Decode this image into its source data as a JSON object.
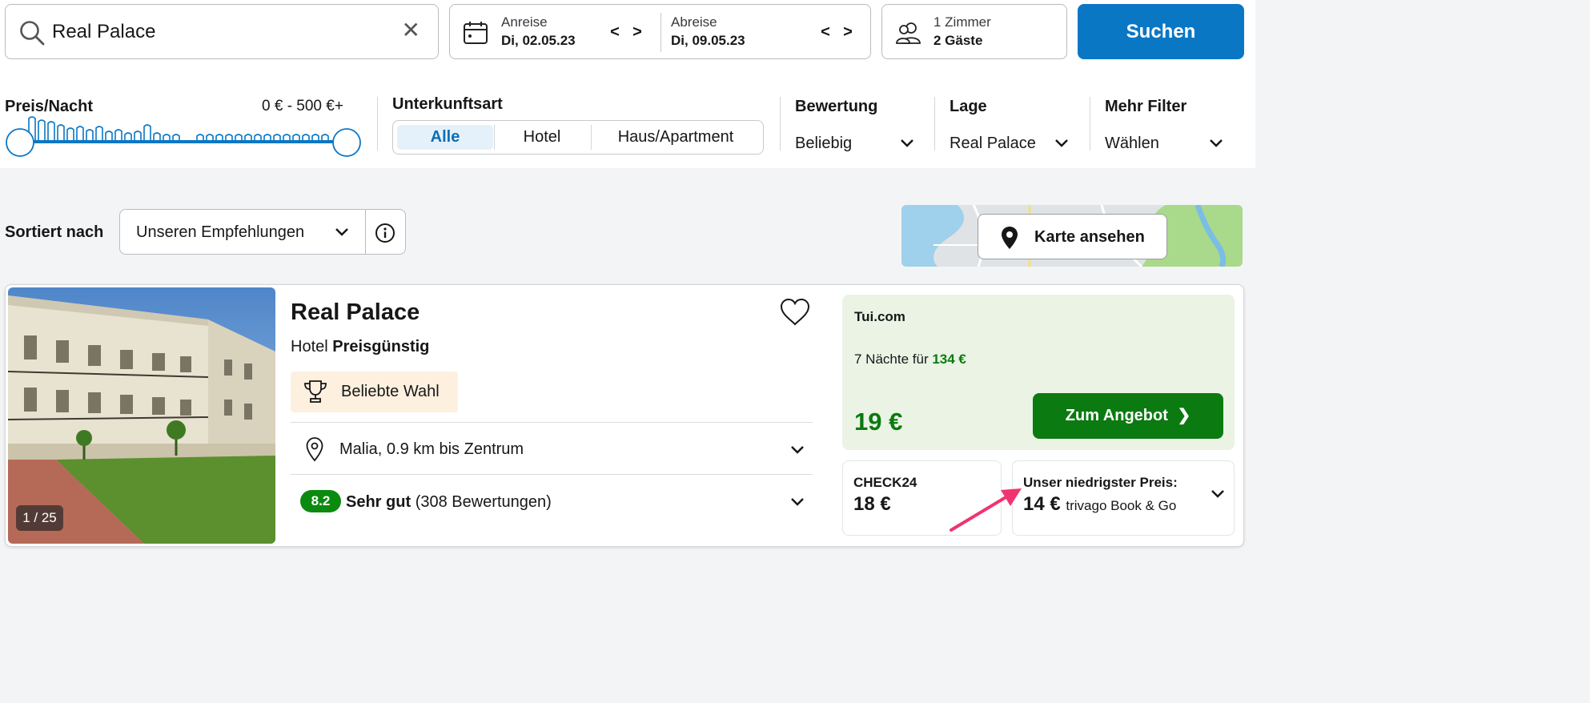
{
  "search": {
    "query": "Real Palace",
    "clear_icon": "close-icon"
  },
  "dates": {
    "checkin_label": "Anreise",
    "checkin_value": "Di, 02.05.23",
    "checkout_label": "Abreise",
    "checkout_value": "Di, 09.05.23"
  },
  "guests": {
    "rooms": "1 Zimmer",
    "guests": "2 Gäste"
  },
  "search_button": "Suchen",
  "filters": {
    "price": {
      "title": "Preis/Nacht",
      "range": "0 € - 500 €+"
    },
    "type": {
      "title": "Unterkunftsart",
      "options": [
        "Alle",
        "Hotel",
        "Haus/Apartment"
      ],
      "selected": "Alle"
    },
    "rating": {
      "title": "Bewertung",
      "value": "Beliebig"
    },
    "location": {
      "title": "Lage",
      "value": "Real Palace"
    },
    "more": {
      "title": "Mehr Filter",
      "value": "Wählen"
    }
  },
  "sort": {
    "label": "Sortiert nach",
    "value": "Unseren Empfehlungen"
  },
  "map": {
    "button": "Karte ansehen"
  },
  "hotel": {
    "name": "Real Palace",
    "type": "Hotel",
    "category": "Preisgünstig",
    "image_counter": "1 / 25",
    "badge": "Beliebte Wahl",
    "location": "Malia, 0.9 km bis Zentrum",
    "rating_score": "8.2",
    "rating_label": "Sehr gut",
    "rating_count": "(308 Bewertungen)"
  },
  "deal": {
    "provider": "Tui.com",
    "nights_text": "7 Nächte für",
    "nights_price": "134 €",
    "price": "19 €",
    "button": "Zum Angebot"
  },
  "alternatives": [
    {
      "provider": "CHECK24",
      "price": "18 €"
    },
    {
      "label": "Unser niedrigster Preis:",
      "price": "14 €",
      "provider": "trivago Book & Go"
    }
  ],
  "colors": {
    "accent_blue": "#0a77c5",
    "deal_green": "#0b7a10",
    "rating_green": "#0b8a10",
    "annotation_pink": "#f0346f"
  }
}
